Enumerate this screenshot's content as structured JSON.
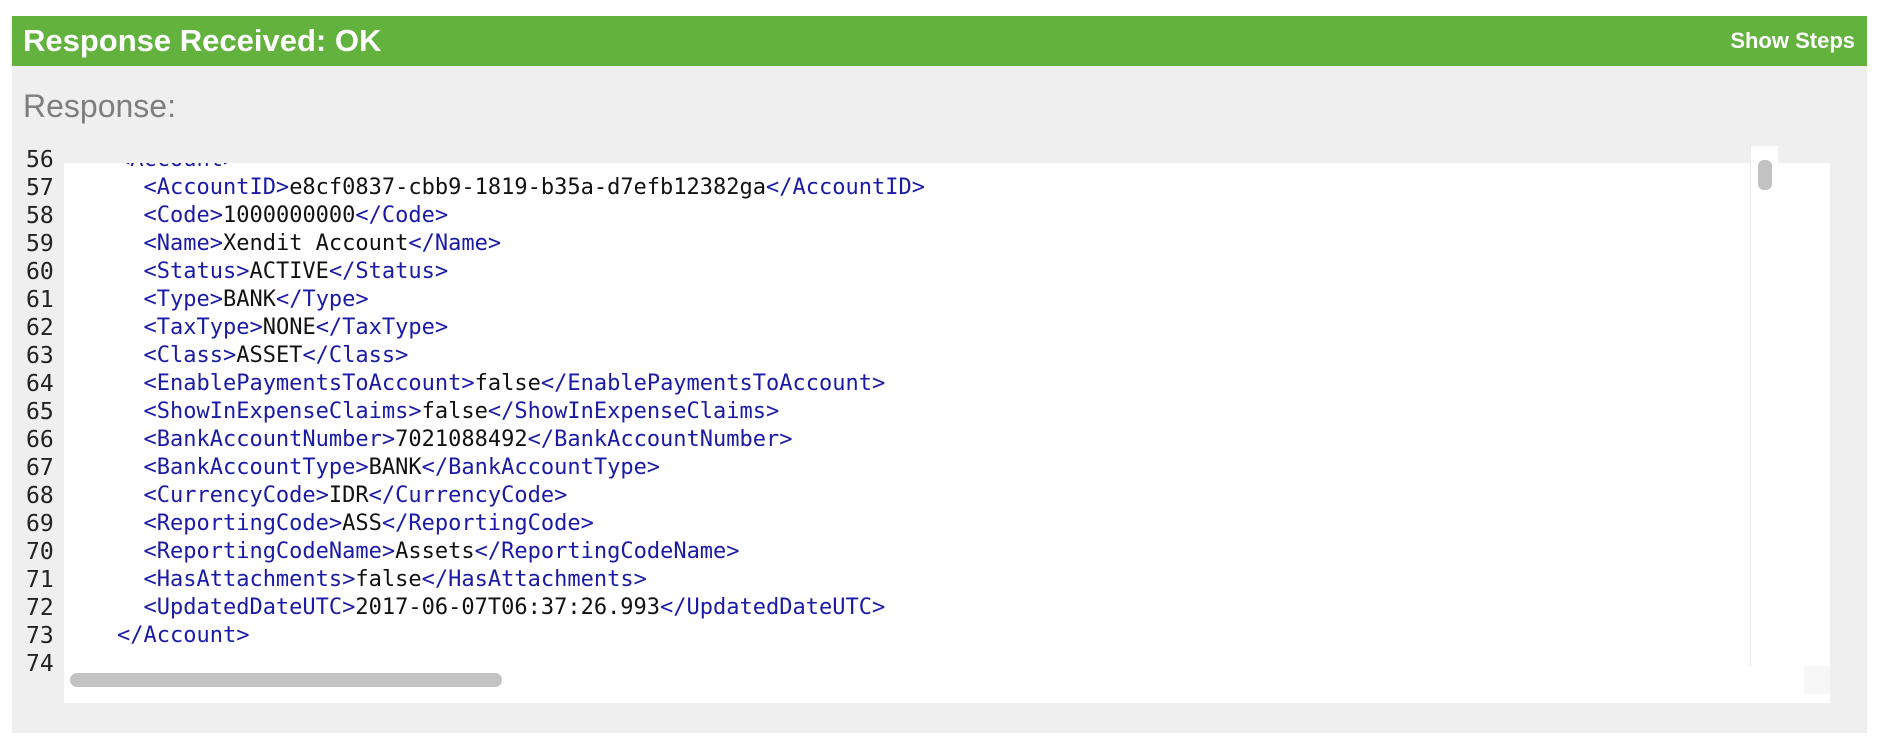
{
  "header": {
    "title": "Response Received: OK",
    "show_steps": "Show Steps"
  },
  "response_label": "Response:",
  "colors": {
    "header_bg": "#62b23d",
    "panel_bg": "#f0efef",
    "tag": "#1a1aa6",
    "value": "#111111"
  },
  "code": {
    "lines": [
      {
        "num": "56",
        "indent": 1,
        "open": "<Account>",
        "value": "",
        "close": ""
      },
      {
        "num": "57",
        "indent": 2,
        "open": "<AccountID>",
        "value": "e8cf0837-cbb9-1819-b35a-d7efb12382ga",
        "close": "</AccountID>"
      },
      {
        "num": "58",
        "indent": 2,
        "open": "<Code>",
        "value": "1000000000",
        "close": "</Code>"
      },
      {
        "num": "59",
        "indent": 2,
        "open": "<Name>",
        "value": "Xendit Account",
        "close": "</Name>"
      },
      {
        "num": "60",
        "indent": 2,
        "open": "<Status>",
        "value": "ACTIVE",
        "close": "</Status>"
      },
      {
        "num": "61",
        "indent": 2,
        "open": "<Type>",
        "value": "BANK",
        "close": "</Type>"
      },
      {
        "num": "62",
        "indent": 2,
        "open": "<TaxType>",
        "value": "NONE",
        "close": "</TaxType>"
      },
      {
        "num": "63",
        "indent": 2,
        "open": "<Class>",
        "value": "ASSET",
        "close": "</Class>"
      },
      {
        "num": "64",
        "indent": 2,
        "open": "<EnablePaymentsToAccount>",
        "value": "false",
        "close": "</EnablePaymentsToAccount>"
      },
      {
        "num": "65",
        "indent": 2,
        "open": "<ShowInExpenseClaims>",
        "value": "false",
        "close": "</ShowInExpenseClaims>"
      },
      {
        "num": "66",
        "indent": 2,
        "open": "<BankAccountNumber>",
        "value": "7021088492",
        "close": "</BankAccountNumber>"
      },
      {
        "num": "67",
        "indent": 2,
        "open": "<BankAccountType>",
        "value": "BANK",
        "close": "</BankAccountType>"
      },
      {
        "num": "68",
        "indent": 2,
        "open": "<CurrencyCode>",
        "value": "IDR",
        "close": "</CurrencyCode>"
      },
      {
        "num": "69",
        "indent": 2,
        "open": "<ReportingCode>",
        "value": "ASS",
        "close": "</ReportingCode>"
      },
      {
        "num": "70",
        "indent": 2,
        "open": "<ReportingCodeName>",
        "value": "Assets",
        "close": "</ReportingCodeName>"
      },
      {
        "num": "71",
        "indent": 2,
        "open": "<HasAttachments>",
        "value": "false",
        "close": "</HasAttachments>"
      },
      {
        "num": "72",
        "indent": 2,
        "open": "<UpdatedDateUTC>",
        "value": "2017-06-07T06:37:26.993",
        "close": "</UpdatedDateUTC>"
      },
      {
        "num": "73",
        "indent": 1,
        "open": "",
        "value": "",
        "close": "</Account>"
      },
      {
        "num": "74",
        "indent": 1,
        "open": "",
        "value": "",
        "close": ""
      }
    ]
  }
}
